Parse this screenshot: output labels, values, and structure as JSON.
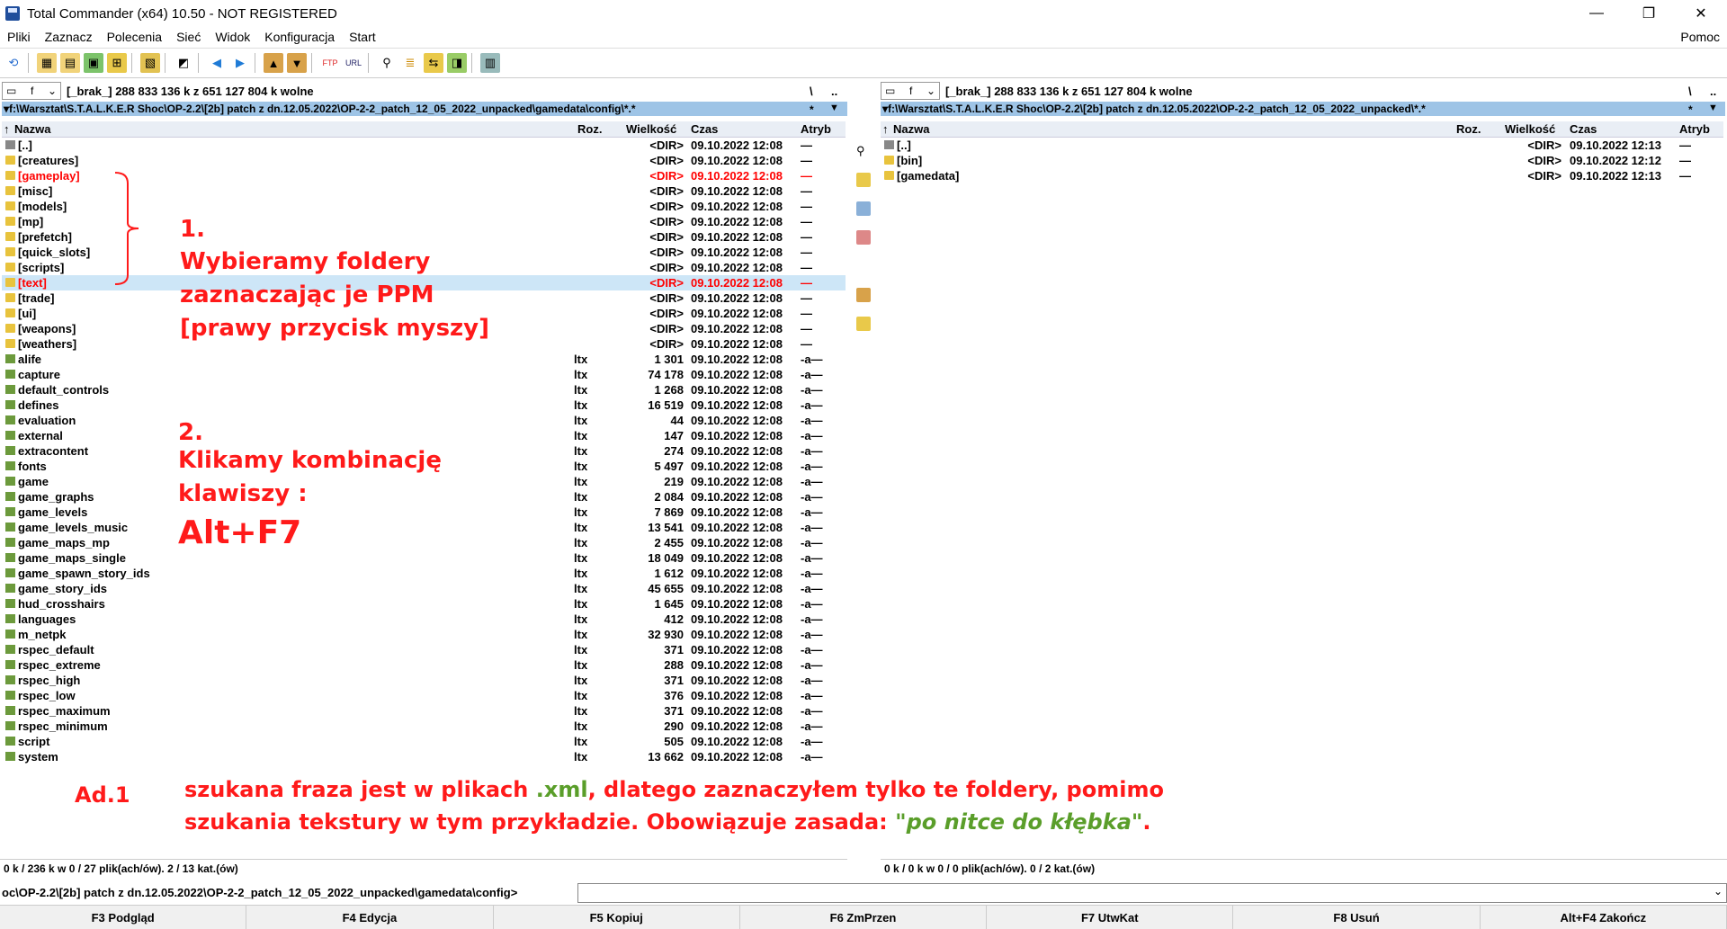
{
  "window": {
    "title": "Total Commander (x64) 10.50 - NOT REGISTERED"
  },
  "menu": [
    "Pliki",
    "Zaznacz",
    "Polecenia",
    "Sieć",
    "Widok",
    "Konfiguracja",
    "Start"
  ],
  "menu_help": "Pomoc",
  "left_panel": {
    "drive": "f",
    "drive_info": "[_brak_]  288 833 136 k z 651 127 804 k wolne",
    "root_btn": "\\",
    "up_btn": "..",
    "path": "f:\\Warsztat\\S.T.A.L.K.E.R Shoc\\OP-2.2\\[2b] patch z dn.12.05.2022\\OP-2-2_patch_12_05_2022_unpacked\\gamedata\\config\\*.*",
    "path_star": "*",
    "columns": {
      "name": "Nazwa",
      "ext": "Roz.",
      "size": "Wielkość",
      "time": "Czas",
      "attr": "Atryb"
    },
    "rows": [
      {
        "name": "[..]",
        "ext": "",
        "size": "<DIR>",
        "time": "09.10.2022 12:08",
        "attr": "—",
        "type": "up"
      },
      {
        "name": "[creatures]",
        "ext": "",
        "size": "<DIR>",
        "time": "09.10.2022 12:08",
        "attr": "—",
        "type": "dir"
      },
      {
        "name": "[gameplay]",
        "ext": "",
        "size": "<DIR>",
        "time": "09.10.2022 12:08",
        "attr": "—",
        "type": "dir",
        "red": true
      },
      {
        "name": "[misc]",
        "ext": "",
        "size": "<DIR>",
        "time": "09.10.2022 12:08",
        "attr": "—",
        "type": "dir"
      },
      {
        "name": "[models]",
        "ext": "",
        "size": "<DIR>",
        "time": "09.10.2022 12:08",
        "attr": "—",
        "type": "dir"
      },
      {
        "name": "[mp]",
        "ext": "",
        "size": "<DIR>",
        "time": "09.10.2022 12:08",
        "attr": "—",
        "type": "dir"
      },
      {
        "name": "[prefetch]",
        "ext": "",
        "size": "<DIR>",
        "time": "09.10.2022 12:08",
        "attr": "—",
        "type": "dir"
      },
      {
        "name": "[quick_slots]",
        "ext": "",
        "size": "<DIR>",
        "time": "09.10.2022 12:08",
        "attr": "—",
        "type": "dir"
      },
      {
        "name": "[scripts]",
        "ext": "",
        "size": "<DIR>",
        "time": "09.10.2022 12:08",
        "attr": "—",
        "type": "dir"
      },
      {
        "name": "[text]",
        "ext": "",
        "size": "<DIR>",
        "time": "09.10.2022 12:08",
        "attr": "—",
        "type": "dir",
        "red": true,
        "sel": true
      },
      {
        "name": "[trade]",
        "ext": "",
        "size": "<DIR>",
        "time": "09.10.2022 12:08",
        "attr": "—",
        "type": "dir"
      },
      {
        "name": "[ui]",
        "ext": "",
        "size": "<DIR>",
        "time": "09.10.2022 12:08",
        "attr": "—",
        "type": "dir"
      },
      {
        "name": "[weapons]",
        "ext": "",
        "size": "<DIR>",
        "time": "09.10.2022 12:08",
        "attr": "—",
        "type": "dir"
      },
      {
        "name": "[weathers]",
        "ext": "",
        "size": "<DIR>",
        "time": "09.10.2022 12:08",
        "attr": "—",
        "type": "dir"
      },
      {
        "name": "alife",
        "ext": "ltx",
        "size": "1 301",
        "time": "09.10.2022 12:08",
        "attr": "-a—",
        "type": "file"
      },
      {
        "name": "capture",
        "ext": "ltx",
        "size": "74 178",
        "time": "09.10.2022 12:08",
        "attr": "-a—",
        "type": "file"
      },
      {
        "name": "default_controls",
        "ext": "ltx",
        "size": "1 268",
        "time": "09.10.2022 12:08",
        "attr": "-a—",
        "type": "file"
      },
      {
        "name": "defines",
        "ext": "ltx",
        "size": "16 519",
        "time": "09.10.2022 12:08",
        "attr": "-a—",
        "type": "file"
      },
      {
        "name": "evaluation",
        "ext": "ltx",
        "size": "44",
        "time": "09.10.2022 12:08",
        "attr": "-a—",
        "type": "file"
      },
      {
        "name": "external",
        "ext": "ltx",
        "size": "147",
        "time": "09.10.2022 12:08",
        "attr": "-a—",
        "type": "file"
      },
      {
        "name": "extracontent",
        "ext": "ltx",
        "size": "274",
        "time": "09.10.2022 12:08",
        "attr": "-a—",
        "type": "file"
      },
      {
        "name": "fonts",
        "ext": "ltx",
        "size": "5 497",
        "time": "09.10.2022 12:08",
        "attr": "-a—",
        "type": "file"
      },
      {
        "name": "game",
        "ext": "ltx",
        "size": "219",
        "time": "09.10.2022 12:08",
        "attr": "-a—",
        "type": "file"
      },
      {
        "name": "game_graphs",
        "ext": "ltx",
        "size": "2 084",
        "time": "09.10.2022 12:08",
        "attr": "-a—",
        "type": "file"
      },
      {
        "name": "game_levels",
        "ext": "ltx",
        "size": "7 869",
        "time": "09.10.2022 12:08",
        "attr": "-a—",
        "type": "file"
      },
      {
        "name": "game_levels_music",
        "ext": "ltx",
        "size": "13 541",
        "time": "09.10.2022 12:08",
        "attr": "-a—",
        "type": "file"
      },
      {
        "name": "game_maps_mp",
        "ext": "ltx",
        "size": "2 455",
        "time": "09.10.2022 12:08",
        "attr": "-a—",
        "type": "file"
      },
      {
        "name": "game_maps_single",
        "ext": "ltx",
        "size": "18 049",
        "time": "09.10.2022 12:08",
        "attr": "-a—",
        "type": "file"
      },
      {
        "name": "game_spawn_story_ids",
        "ext": "ltx",
        "size": "1 612",
        "time": "09.10.2022 12:08",
        "attr": "-a—",
        "type": "file"
      },
      {
        "name": "game_story_ids",
        "ext": "ltx",
        "size": "45 655",
        "time": "09.10.2022 12:08",
        "attr": "-a—",
        "type": "file"
      },
      {
        "name": "hud_crosshairs",
        "ext": "ltx",
        "size": "1 645",
        "time": "09.10.2022 12:08",
        "attr": "-a—",
        "type": "file"
      },
      {
        "name": "languages",
        "ext": "ltx",
        "size": "412",
        "time": "09.10.2022 12:08",
        "attr": "-a—",
        "type": "file"
      },
      {
        "name": "m_netpk",
        "ext": "ltx",
        "size": "32 930",
        "time": "09.10.2022 12:08",
        "attr": "-a—",
        "type": "file"
      },
      {
        "name": "rspec_default",
        "ext": "ltx",
        "size": "371",
        "time": "09.10.2022 12:08",
        "attr": "-a—",
        "type": "file"
      },
      {
        "name": "rspec_extreme",
        "ext": "ltx",
        "size": "288",
        "time": "09.10.2022 12:08",
        "attr": "-a—",
        "type": "file"
      },
      {
        "name": "rspec_high",
        "ext": "ltx",
        "size": "371",
        "time": "09.10.2022 12:08",
        "attr": "-a—",
        "type": "file"
      },
      {
        "name": "rspec_low",
        "ext": "ltx",
        "size": "376",
        "time": "09.10.2022 12:08",
        "attr": "-a—",
        "type": "file"
      },
      {
        "name": "rspec_maximum",
        "ext": "ltx",
        "size": "371",
        "time": "09.10.2022 12:08",
        "attr": "-a—",
        "type": "file"
      },
      {
        "name": "rspec_minimum",
        "ext": "ltx",
        "size": "290",
        "time": "09.10.2022 12:08",
        "attr": "-a—",
        "type": "file"
      },
      {
        "name": "script",
        "ext": "ltx",
        "size": "505",
        "time": "09.10.2022 12:08",
        "attr": "-a—",
        "type": "file"
      },
      {
        "name": "system",
        "ext": "ltx",
        "size": "13 662",
        "time": "09.10.2022 12:08",
        "attr": "-a—",
        "type": "file"
      }
    ],
    "status": "0 k / 236 k w 0 / 27 plik(ach/ów). 2 / 13 kat.(ów)"
  },
  "right_panel": {
    "drive": "f",
    "drive_info": "[_brak_]  288 833 136 k z 651 127 804 k wolne",
    "root_btn": "\\",
    "up_btn": "..",
    "path": "f:\\Warsztat\\S.T.A.L.K.E.R Shoc\\OP-2.2\\[2b] patch z dn.12.05.2022\\OP-2-2_patch_12_05_2022_unpacked\\*.*",
    "path_star": "*",
    "columns": {
      "name": "Nazwa",
      "ext": "Roz.",
      "size": "Wielkość",
      "time": "Czas",
      "attr": "Atryb"
    },
    "rows": [
      {
        "name": "[..]",
        "ext": "",
        "size": "<DIR>",
        "time": "09.10.2022 12:13",
        "attr": "—",
        "type": "up"
      },
      {
        "name": "[bin]",
        "ext": "",
        "size": "<DIR>",
        "time": "09.10.2022 12:12",
        "attr": "—",
        "type": "dir"
      },
      {
        "name": "[gamedata]",
        "ext": "",
        "size": "<DIR>",
        "time": "09.10.2022 12:13",
        "attr": "—",
        "type": "dir"
      }
    ],
    "status": "0 k / 0 k w 0 / 0 plik(ach/ów). 0 / 2 kat.(ów)"
  },
  "command_line": {
    "prompt": "oc\\OP-2.2\\[2b] patch z dn.12.05.2022\\OP-2-2_patch_12_05_2022_unpacked\\gamedata\\config>"
  },
  "fkeys": [
    "F3 Podgląd",
    "F4 Edycja",
    "F5 Kopiuj",
    "F6 ZmPrzen",
    "F7 UtwKat",
    "F8 Usuń",
    "Alt+F4 Zakończ"
  ],
  "annotations": {
    "step1_num": "1.",
    "step1_l1": "Wybieramy foldery",
    "step1_l2": "zaznaczając je PPM",
    "step1_l3": "[prawy przycisk myszy]",
    "step2_num": "2.",
    "step2_l1": "Klikamy kombinację",
    "step2_l2": "klawiszy :",
    "step2_key": "Alt+F7",
    "ad_label": "Ad.1",
    "note_l1_a": "szukana fraza jest w plikach ",
    "note_l1_ext": ".xml",
    "note_l1_b": ", dlatego zaznaczyłem tylko te foldery, pomimo",
    "note_l2_a": "szukania tekstury w tym przykładzie. Obowiązuje zasada: ",
    "note_l2_quote": "\"po nitce do kłębka\"",
    "note_l2_b": "."
  },
  "colors": {
    "accent_red": "#ff1a1a",
    "accent_green": "#5a9e2a",
    "path_bar": "#9ec4e6",
    "selection": "#cde6f7"
  }
}
